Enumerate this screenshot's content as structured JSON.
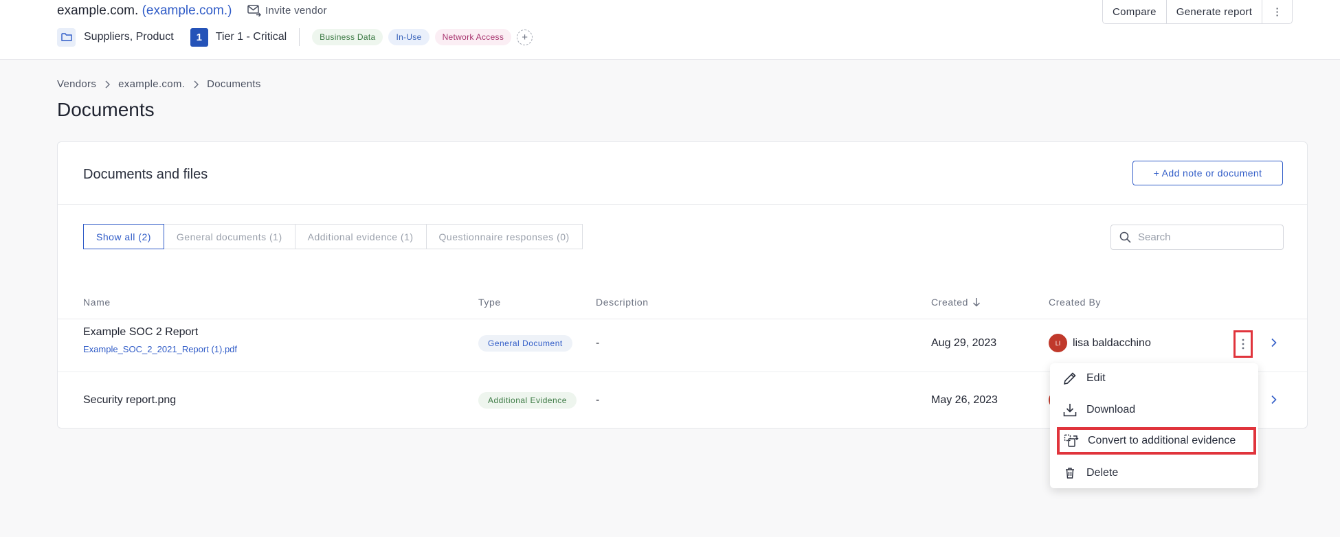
{
  "header": {
    "vendor_name": "example.com.",
    "vendor_link": "(example.com.)",
    "invite_label": "Invite vendor",
    "categories": "Suppliers, Product",
    "tier_number": "1",
    "tier_label": "Tier 1 - Critical",
    "tags": [
      "Business Data",
      "In-Use",
      "Network Access"
    ],
    "add_tag": "+",
    "buttons": {
      "compare": "Compare",
      "generate_report": "Generate report",
      "more": "⋮"
    }
  },
  "breadcrumb": [
    "Vendors",
    "example.com.",
    "Documents"
  ],
  "page_title": "Documents",
  "card": {
    "title": "Documents and files",
    "add_button": "+ Add note or document",
    "tabs": [
      "Show all (2)",
      "General documents (1)",
      "Additional evidence (1)",
      "Questionnaire responses (0)"
    ],
    "active_tab": "Show all (2)",
    "search_placeholder": "Search",
    "columns": [
      "Name",
      "Type",
      "Description",
      "Created",
      "Created By"
    ],
    "rows": [
      {
        "name": "Example SOC 2 Report",
        "file": "Example_SOC_2_2021_Report (1).pdf",
        "type": "General Document",
        "description": "-",
        "created": "Aug 29, 2023",
        "created_by_initials": "LI",
        "created_by": "lisa baldacchino"
      },
      {
        "name": "Security report.png",
        "type": "Additional Evidence",
        "description": "-",
        "created": "May 26, 2023"
      }
    ]
  },
  "menu": {
    "items": [
      "Edit",
      "Download",
      "Convert to additional evidence",
      "Delete"
    ]
  },
  "colors": {
    "accent": "#2f5bc7",
    "highlight": "#e0343c",
    "avatar": "#c0392b"
  }
}
